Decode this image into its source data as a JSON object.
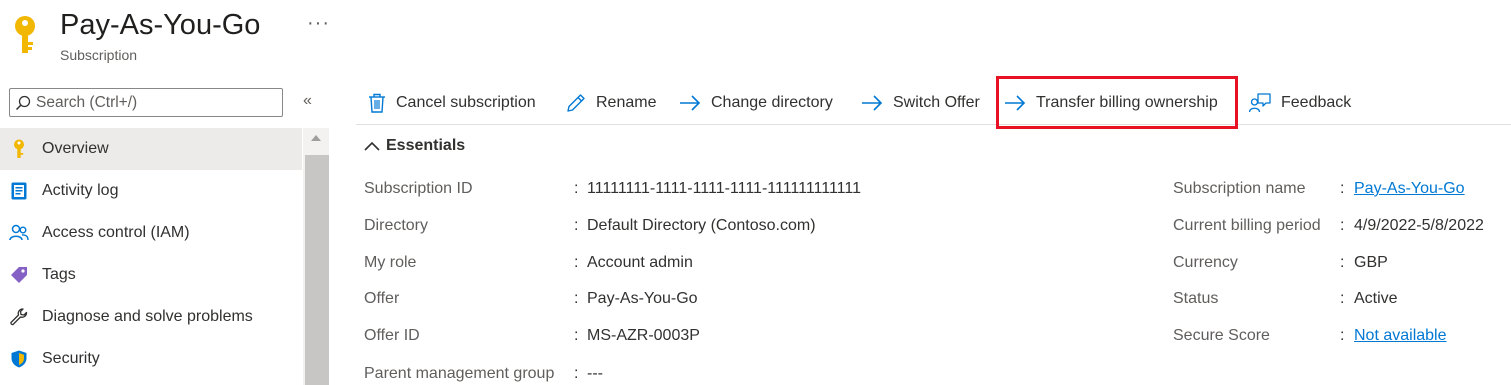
{
  "header": {
    "title": "Pay-As-You-Go",
    "subtitle": "Subscription",
    "more": "···"
  },
  "sidebar": {
    "search_placeholder": "Search (Ctrl+/)",
    "collapse": "«",
    "items": [
      {
        "label": "Overview",
        "icon": "key-icon",
        "active": true
      },
      {
        "label": "Activity log",
        "icon": "activity-log-icon"
      },
      {
        "label": "Access control (IAM)",
        "icon": "people-icon"
      },
      {
        "label": "Tags",
        "icon": "tag-icon"
      },
      {
        "label": "Diagnose and solve problems",
        "icon": "wrench-icon"
      },
      {
        "label": "Security",
        "icon": "shield-icon"
      }
    ]
  },
  "toolbar": {
    "cancel": "Cancel subscription",
    "rename": "Rename",
    "change_directory": "Change directory",
    "switch_offer": "Switch Offer",
    "transfer": "Transfer billing ownership",
    "feedback": "Feedback"
  },
  "essentials": {
    "title": "Essentials",
    "left": [
      {
        "label": "Subscription ID",
        "value": "11111111-1111-1111-1111-111111111111"
      },
      {
        "label": "Directory",
        "value": "Default Directory (Contoso.com)"
      },
      {
        "label": "My role",
        "value": "Account admin"
      },
      {
        "label": "Offer",
        "value": "Pay-As-You-Go"
      },
      {
        "label": "Offer ID",
        "value": "MS-AZR-0003P"
      },
      {
        "label": "Parent management group",
        "value": "---"
      }
    ],
    "right": [
      {
        "label": "Subscription name",
        "value": "Pay-As-You-Go",
        "link": true
      },
      {
        "label": "Current billing period",
        "value": "4/9/2022-5/8/2022"
      },
      {
        "label": "Currency",
        "value": "GBP"
      },
      {
        "label": "Status",
        "value": "Active"
      },
      {
        "label": "Secure Score",
        "value": "Not available",
        "link": true
      }
    ]
  },
  "colors": {
    "accent": "#0078d4",
    "highlight": "#e81123",
    "key": "#f2b700"
  }
}
